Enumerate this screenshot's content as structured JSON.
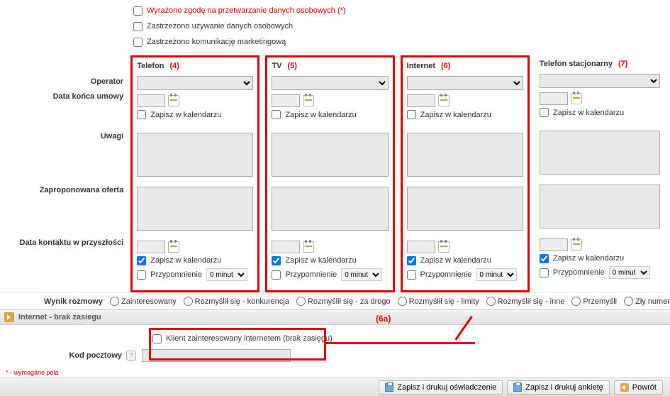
{
  "consents": {
    "c1": "Wyrażono zgodę na przetwarzanie danych osobowych (*)",
    "c2": "Zastrzeżono używanie danych osobowych",
    "c3": "Zastrzeżono komunikację marketingową"
  },
  "labels": {
    "operator": "Operator",
    "end_date": "Data końca umowy",
    "save_calendar": "Zapisz w kalendarzu",
    "notes": "Uwagi",
    "proposed": "Zaproponowana oferta",
    "future_contact": "Data kontaktu w przyszłości",
    "reminder": "Przypomnienie",
    "reminder_val": "0 minut",
    "result": "Wynik rozmowy",
    "section_internet": "Internet - brak zasiegu",
    "client_interested": "Klient zainteresowany internetem (brak zasięgu)",
    "postal": "Kod pocztowy",
    "required_note": "* - wymagane pola"
  },
  "services": [
    {
      "title": "Telefon",
      "num": "(4)",
      "save_future": true,
      "annot": true
    },
    {
      "title": "TV",
      "num": "(5)",
      "save_future": true,
      "annot": true
    },
    {
      "title": "Internet",
      "num": "(6)",
      "save_future": true,
      "annot": true
    },
    {
      "title": "Telefon stacjonarny",
      "num": "(7)",
      "save_future": true,
      "annot": false
    }
  ],
  "annot6a": "(6a)",
  "results": [
    "Zainteresowany",
    "Rozmyślił się - konkurencja",
    "Rozmyślił się - za drogo",
    "Rozmyślił się - limity",
    "Rozmyślił się - inne",
    "Przemyśli",
    "Zły numer"
  ],
  "buttons": {
    "b1": "Zapisz i drukuj oświadczenie",
    "b2": "Zapisz i drukuj ankietę",
    "b3": "Powrót"
  }
}
